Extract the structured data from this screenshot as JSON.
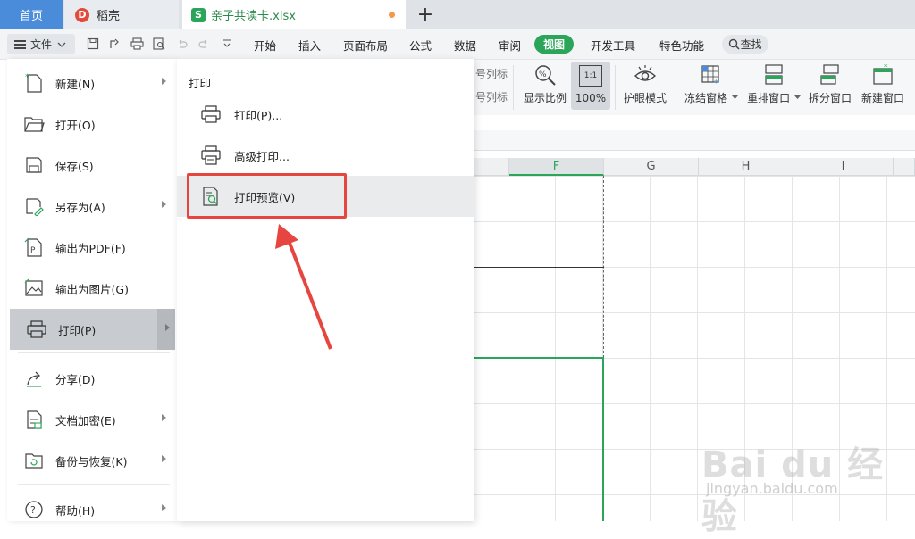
{
  "tabs": {
    "home": "首页",
    "daoke": "稻壳",
    "file": "亲子共读卡.xlsx",
    "plus": "+"
  },
  "menubar": {
    "file_label": "文件",
    "items": [
      "开始",
      "插入",
      "页面布局",
      "公式",
      "数据",
      "审阅",
      "视图",
      "开发工具",
      "特色功能",
      "查找"
    ],
    "active": "视图"
  },
  "ribbon": {
    "partial_top": "号列标",
    "partial_bottom": "号列标",
    "zoom_ratio": "显示比例",
    "zoom_100": "100%",
    "eye_mode": "护眼模式",
    "freeze": "冻结窗格",
    "rearrange": "重排窗口",
    "split": "拆分窗口",
    "new_window": "新建窗口",
    "zoom_icon_text": "1:1"
  },
  "sheet": {
    "columns": [
      "F",
      "G",
      "H",
      "I"
    ],
    "selected_column": "F"
  },
  "file_menu": {
    "items": [
      {
        "label": "新建(N)",
        "arrow": true
      },
      {
        "label": "打开(O)",
        "arrow": false
      },
      {
        "label": "保存(S)",
        "arrow": false
      },
      {
        "label": "另存为(A)",
        "arrow": true
      },
      {
        "label": "输出为PDF(F)",
        "arrow": false
      },
      {
        "label": "输出为图片(G)",
        "arrow": false
      },
      {
        "label": "打印(P)",
        "arrow": true
      },
      {
        "label": "分享(D)",
        "arrow": false
      },
      {
        "label": "文档加密(E)",
        "arrow": true
      },
      {
        "label": "备份与恢复(K)",
        "arrow": true
      },
      {
        "label": "帮助(H)",
        "arrow": true
      }
    ],
    "active": "打印(P)"
  },
  "print_submenu": {
    "title": "打印",
    "items": [
      {
        "label": "打印(P)..."
      },
      {
        "label": "高级打印..."
      },
      {
        "label": "打印预览(V)"
      }
    ]
  },
  "watermark": {
    "main": "Bai du 经验",
    "url": "jingyan.baidu.com"
  },
  "colors": {
    "accent_green": "#2aa55a",
    "tab_blue": "#4a8cd9",
    "highlight_red": "#e6463f"
  }
}
